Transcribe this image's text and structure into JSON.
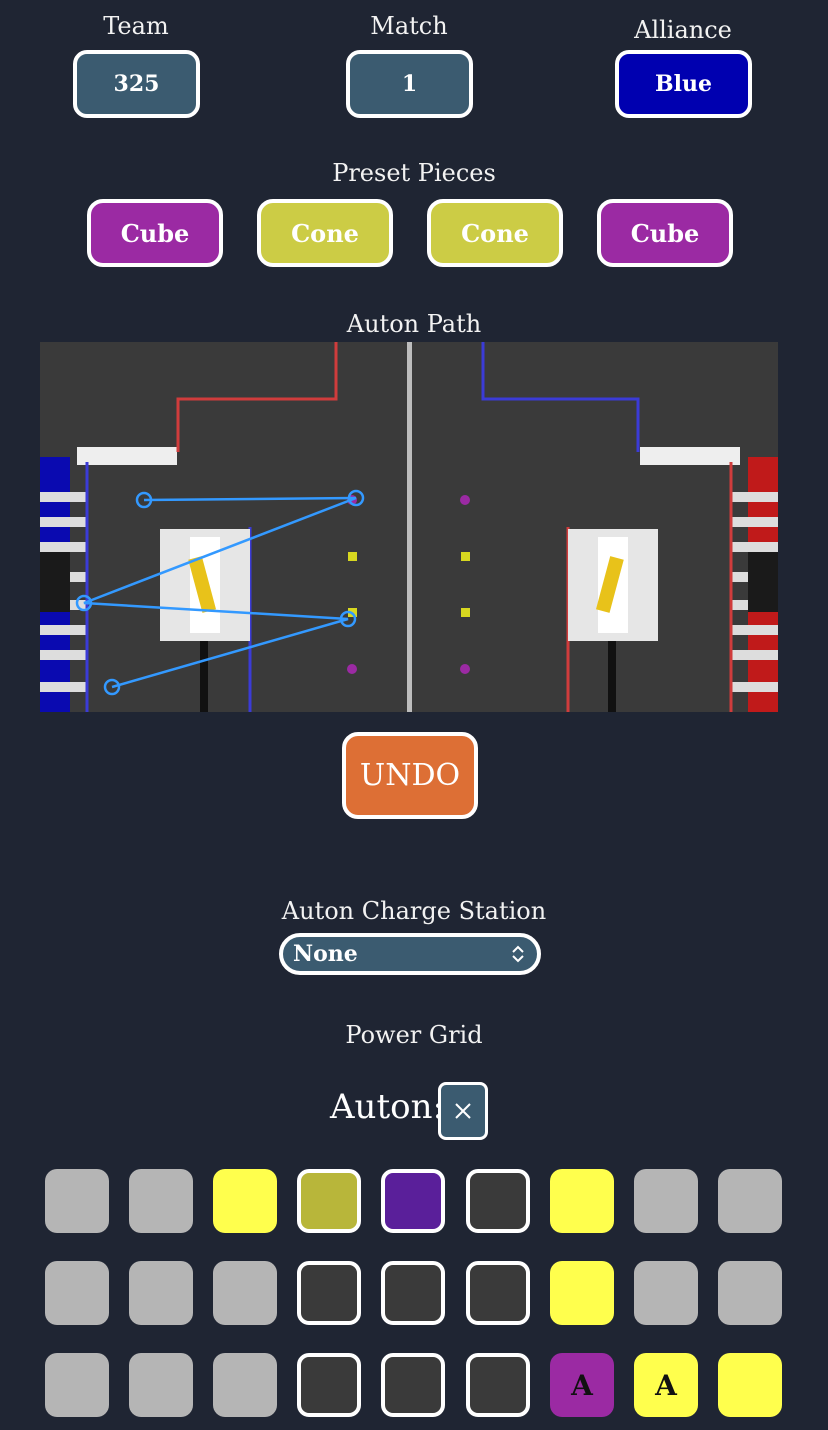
{
  "header": {
    "team": {
      "label": "Team",
      "value": "325"
    },
    "match": {
      "label": "Match",
      "value": "1"
    },
    "alliance": {
      "label": "Alliance",
      "value": "Blue",
      "color": "#0000b0"
    }
  },
  "preset": {
    "label": "Preset Pieces",
    "pieces": [
      "Cube",
      "Cone",
      "Cone",
      "Cube"
    ]
  },
  "auton_path": {
    "label": "Auton Path"
  },
  "undo_label": "UNDO",
  "charge_station": {
    "label": "Auton Charge Station",
    "value": "None"
  },
  "power_grid": {
    "label": "Power Grid",
    "auton_label": "Auton:",
    "rows": [
      [
        "empty",
        "empty",
        "yellow",
        "olive",
        "purple",
        "slot",
        "yellow",
        "empty",
        "empty"
      ],
      [
        "empty",
        "empty",
        "empty",
        "slot",
        "slot",
        "slot",
        "yellow",
        "empty",
        "empty"
      ],
      [
        "empty",
        "empty",
        "empty",
        "slot",
        "slot",
        "slot",
        "magenta",
        "yellow",
        "yellow"
      ]
    ],
    "row3_cell7_text": "A",
    "row3_cell8_text": "A"
  },
  "colors": {
    "background": "#1f2533",
    "field_bg": "#3b5b70",
    "cube": "#9b2aa3",
    "cone": "#cccc45",
    "undo": "#dd6f35",
    "path_line": "#3399ff"
  }
}
